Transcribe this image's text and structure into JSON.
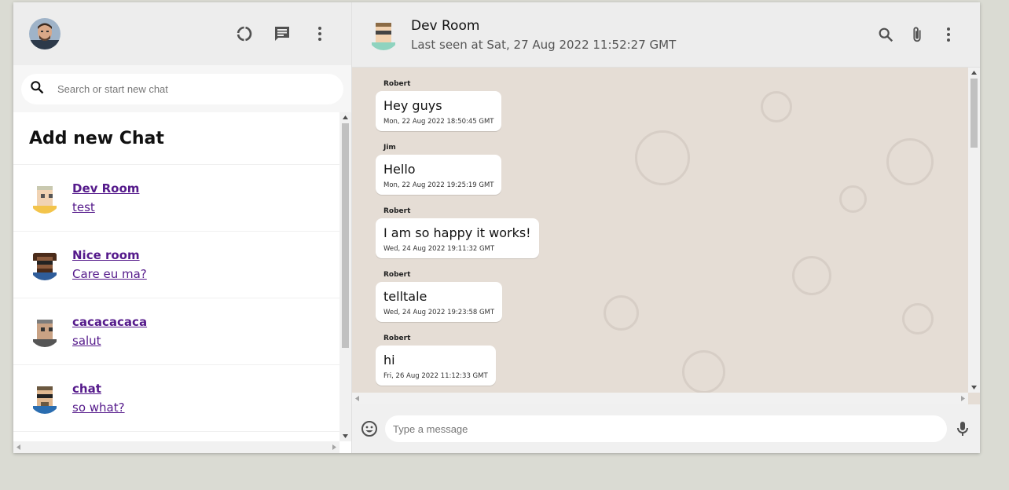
{
  "sidebar": {
    "header_icons": [
      "status-icon",
      "chat-icon",
      "more-vert-icon"
    ],
    "search": {
      "placeholder": "Search or start new chat"
    },
    "add_new_chat": "Add new Chat",
    "chats": [
      {
        "name": "Dev Room",
        "last_message": "test"
      },
      {
        "name": "Nice room",
        "last_message": "Care eu ma?"
      },
      {
        "name": "cacacacaca",
        "last_message": "salut"
      },
      {
        "name": "chat",
        "last_message": "so what?"
      }
    ]
  },
  "chat": {
    "title": "Dev Room",
    "subtitle": "Last seen at Sat, 27 Aug 2022 11:52:27 GMT",
    "header_icons": [
      "search-icon",
      "attach-icon",
      "more-vert-icon"
    ],
    "messages": [
      {
        "author": "Robert",
        "text": "Hey guys",
        "time": "Mon, 22 Aug 2022 18:50:45 GMT"
      },
      {
        "author": "Jim",
        "text": "Hello",
        "time": "Mon, 22 Aug 2022 19:25:19 GMT"
      },
      {
        "author": "Robert",
        "text": "I am so happy it works!",
        "time": "Wed, 24 Aug 2022 19:11:32 GMT"
      },
      {
        "author": "Robert",
        "text": "telltale",
        "time": "Wed, 24 Aug 2022 19:23:58 GMT"
      },
      {
        "author": "Robert",
        "text": "hi",
        "time": "Fri, 26 Aug 2022 11:12:33 GMT"
      }
    ],
    "footer": {
      "placeholder": "Type a message"
    }
  },
  "colors": {
    "header_bg": "#ededed",
    "chat_bg": "#e5ddd5",
    "link": "#551a8b",
    "icon": "#515151"
  }
}
